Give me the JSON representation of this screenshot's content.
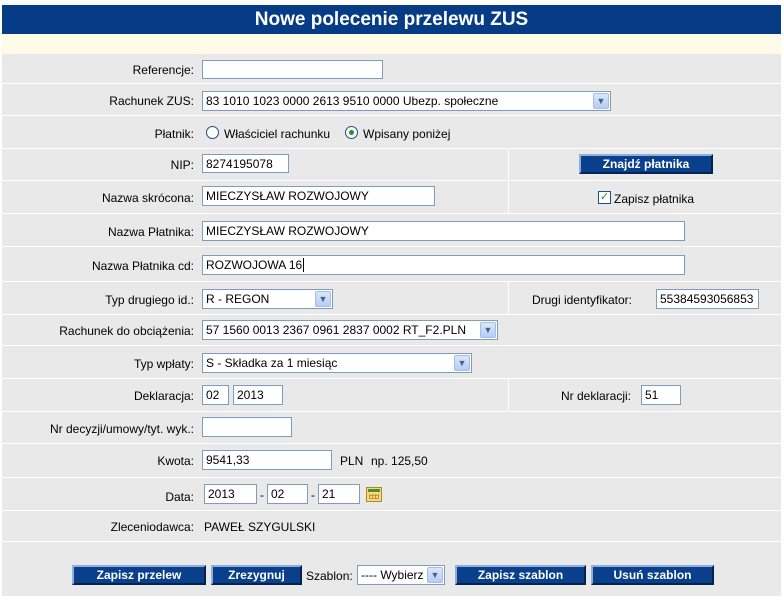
{
  "page": {
    "title": "Nowe polecenie przelewu ZUS"
  },
  "form": {
    "referencje": {
      "label": "Referencje:",
      "value": ""
    },
    "rachunek_zus": {
      "label": "Rachunek ZUS:",
      "value": "83 1010 1023 0000 2613 9510 0000 Ubezp. społeczne"
    },
    "platnik": {
      "label": "Płatnik:",
      "options": [
        "Właściciel rachunku",
        "Wpisany poniżej"
      ],
      "selected": "Wpisany poniżej"
    },
    "nip": {
      "label": "NIP:",
      "value": "8274195078"
    },
    "znajdz_button": "Znajdź płatnika",
    "nazwa_skrocona": {
      "label": "Nazwa skrócona:",
      "value": "MIECZYSŁAW ROZWOJOWY"
    },
    "zapisz_platnika": {
      "label": "Zapisz płatnika",
      "checked": true
    },
    "nazwa_platnika": {
      "label": "Nazwa Płatnika:",
      "value": "MIECZYSŁAW ROZWOJOWY"
    },
    "nazwa_platnika_cd": {
      "label": "Nazwa Płatnika cd:",
      "value": "ROZWOJOWA 16"
    },
    "typ_drugiego_id": {
      "label": "Typ drugiego id.:",
      "value": "R - REGON"
    },
    "drugi_identyfikator": {
      "label": "Drugi identyfikator:",
      "value": "55384593056853"
    },
    "rachunek_obciazenia": {
      "label": "Rachunek do obciążenia:",
      "value": "57 1560 0013 2367 0961 2837 0002  RT_F2.PLN"
    },
    "typ_wplaty": {
      "label": "Typ wpłaty:",
      "value": "S - Składka za 1 miesiąc"
    },
    "deklaracja": {
      "label": "Deklaracja:",
      "month": "02",
      "year": "2013"
    },
    "nr_deklaracji": {
      "label": "Nr deklaracji:",
      "value": "51"
    },
    "nr_decyzji": {
      "label": "Nr decyzji/umowy/tyt. wyk.:",
      "value": ""
    },
    "kwota": {
      "label": "Kwota:",
      "value": "9541,33",
      "currency": "PLN",
      "hint": "np. 125,50"
    },
    "data": {
      "label": "Data:",
      "year": "2013",
      "month": "02",
      "day": "21",
      "sep": "-"
    },
    "zleceniodawca": {
      "label": "Zleceniodawca:",
      "value": "PAWEŁ SZYGULSKI"
    }
  },
  "footer": {
    "zapisz_przelew": "Zapisz przelew",
    "zrezygnuj": "Zrezygnuj",
    "szablon_label": "Szablon:",
    "szablon_value": "---- Wybierz",
    "zapisz_szablon": "Zapisz szablon",
    "usun_szablon": "Usuń szablon"
  },
  "colors": {
    "title_bg": "#063b86",
    "button_bg": "#0a3f8c",
    "form_bg": "#e9e9e9"
  },
  "icons": {
    "dropdown": "chevron-down-icon",
    "calendar": "calendar-icon"
  }
}
